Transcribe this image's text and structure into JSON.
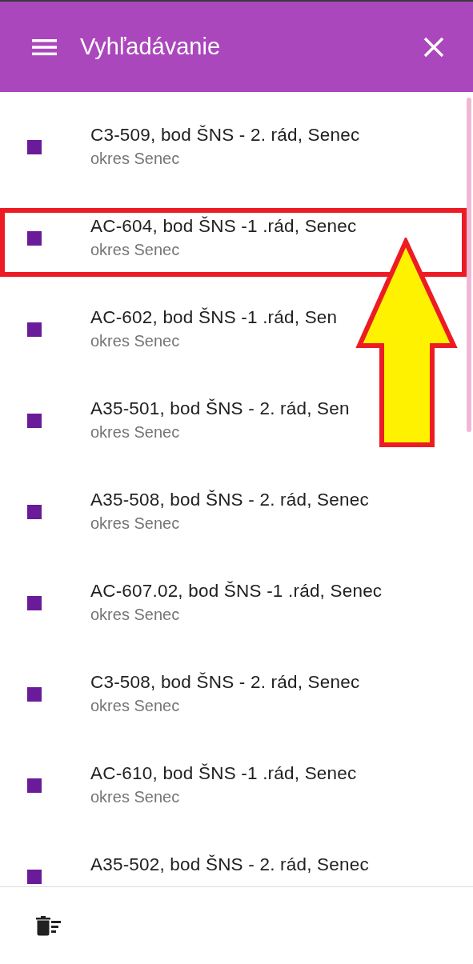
{
  "app_bar": {
    "title": "Vyhľadávanie"
  },
  "results": [
    {
      "title": "C3-509, bod ŠNS - 2. rád, Senec",
      "subtitle": "okres Senec",
      "color": "#6a1b9a",
      "highlighted": false
    },
    {
      "title": "AC-604, bod ŠNS -1 .rád, Senec",
      "subtitle": "okres Senec",
      "color": "#6a1b9a",
      "highlighted": true
    },
    {
      "title": "AC-602, bod ŠNS -1 .rád, Sen",
      "subtitle": "okres Senec",
      "color": "#6a1b9a",
      "highlighted": false
    },
    {
      "title": "A35-501, bod ŠNS - 2. rád, Sen",
      "subtitle": "okres Senec",
      "color": "#6a1b9a",
      "highlighted": false
    },
    {
      "title": "A35-508, bod ŠNS - 2. rád, Senec",
      "subtitle": "okres Senec",
      "color": "#6a1b9a",
      "highlighted": false
    },
    {
      "title": "AC-607.02, bod ŠNS -1 .rád, Senec",
      "subtitle": "okres Senec",
      "color": "#6a1b9a",
      "highlighted": false
    },
    {
      "title": "C3-508, bod ŠNS - 2. rád, Senec",
      "subtitle": "okres Senec",
      "color": "#6a1b9a",
      "highlighted": false
    },
    {
      "title": "AC-610, bod ŠNS -1 .rád, Senec",
      "subtitle": "okres Senec",
      "color": "#6a1b9a",
      "highlighted": false
    },
    {
      "title": "A35-502, bod ŠNS - 2. rád, Senec",
      "color": "#6a1b9a",
      "highlighted": false
    }
  ]
}
